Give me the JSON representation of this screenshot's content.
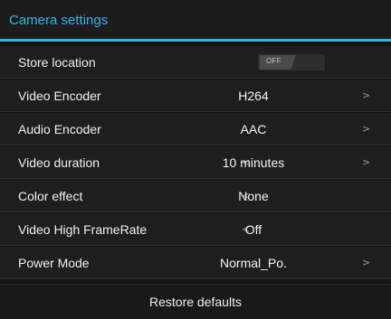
{
  "dialog": {
    "title": "Camera settings",
    "accent_color": "#33b5e5"
  },
  "settings": [
    {
      "label": "Store location",
      "control": "toggle",
      "value": "OFF"
    },
    {
      "label": "Video Encoder",
      "value": "H264",
      "left_arrow": false,
      "right_arrow": true
    },
    {
      "label": "Audio Encoder",
      "value": "AAC",
      "left_arrow": false,
      "right_arrow": true
    },
    {
      "label": "Video duration",
      "value": "10 minutes",
      "left_arrow": true,
      "right_arrow": true
    },
    {
      "label": "Color effect",
      "value": "None",
      "left_arrow": true,
      "right_arrow": false
    },
    {
      "label": "Video High FrameRate",
      "value": "Off",
      "left_arrow": true,
      "right_arrow": false
    },
    {
      "label": "Power Mode",
      "value": "Normal_Po.",
      "left_arrow": false,
      "right_arrow": true
    }
  ],
  "arrows": {
    "left": "<",
    "right": ">"
  },
  "footer": {
    "restore_label": "Restore defaults"
  }
}
